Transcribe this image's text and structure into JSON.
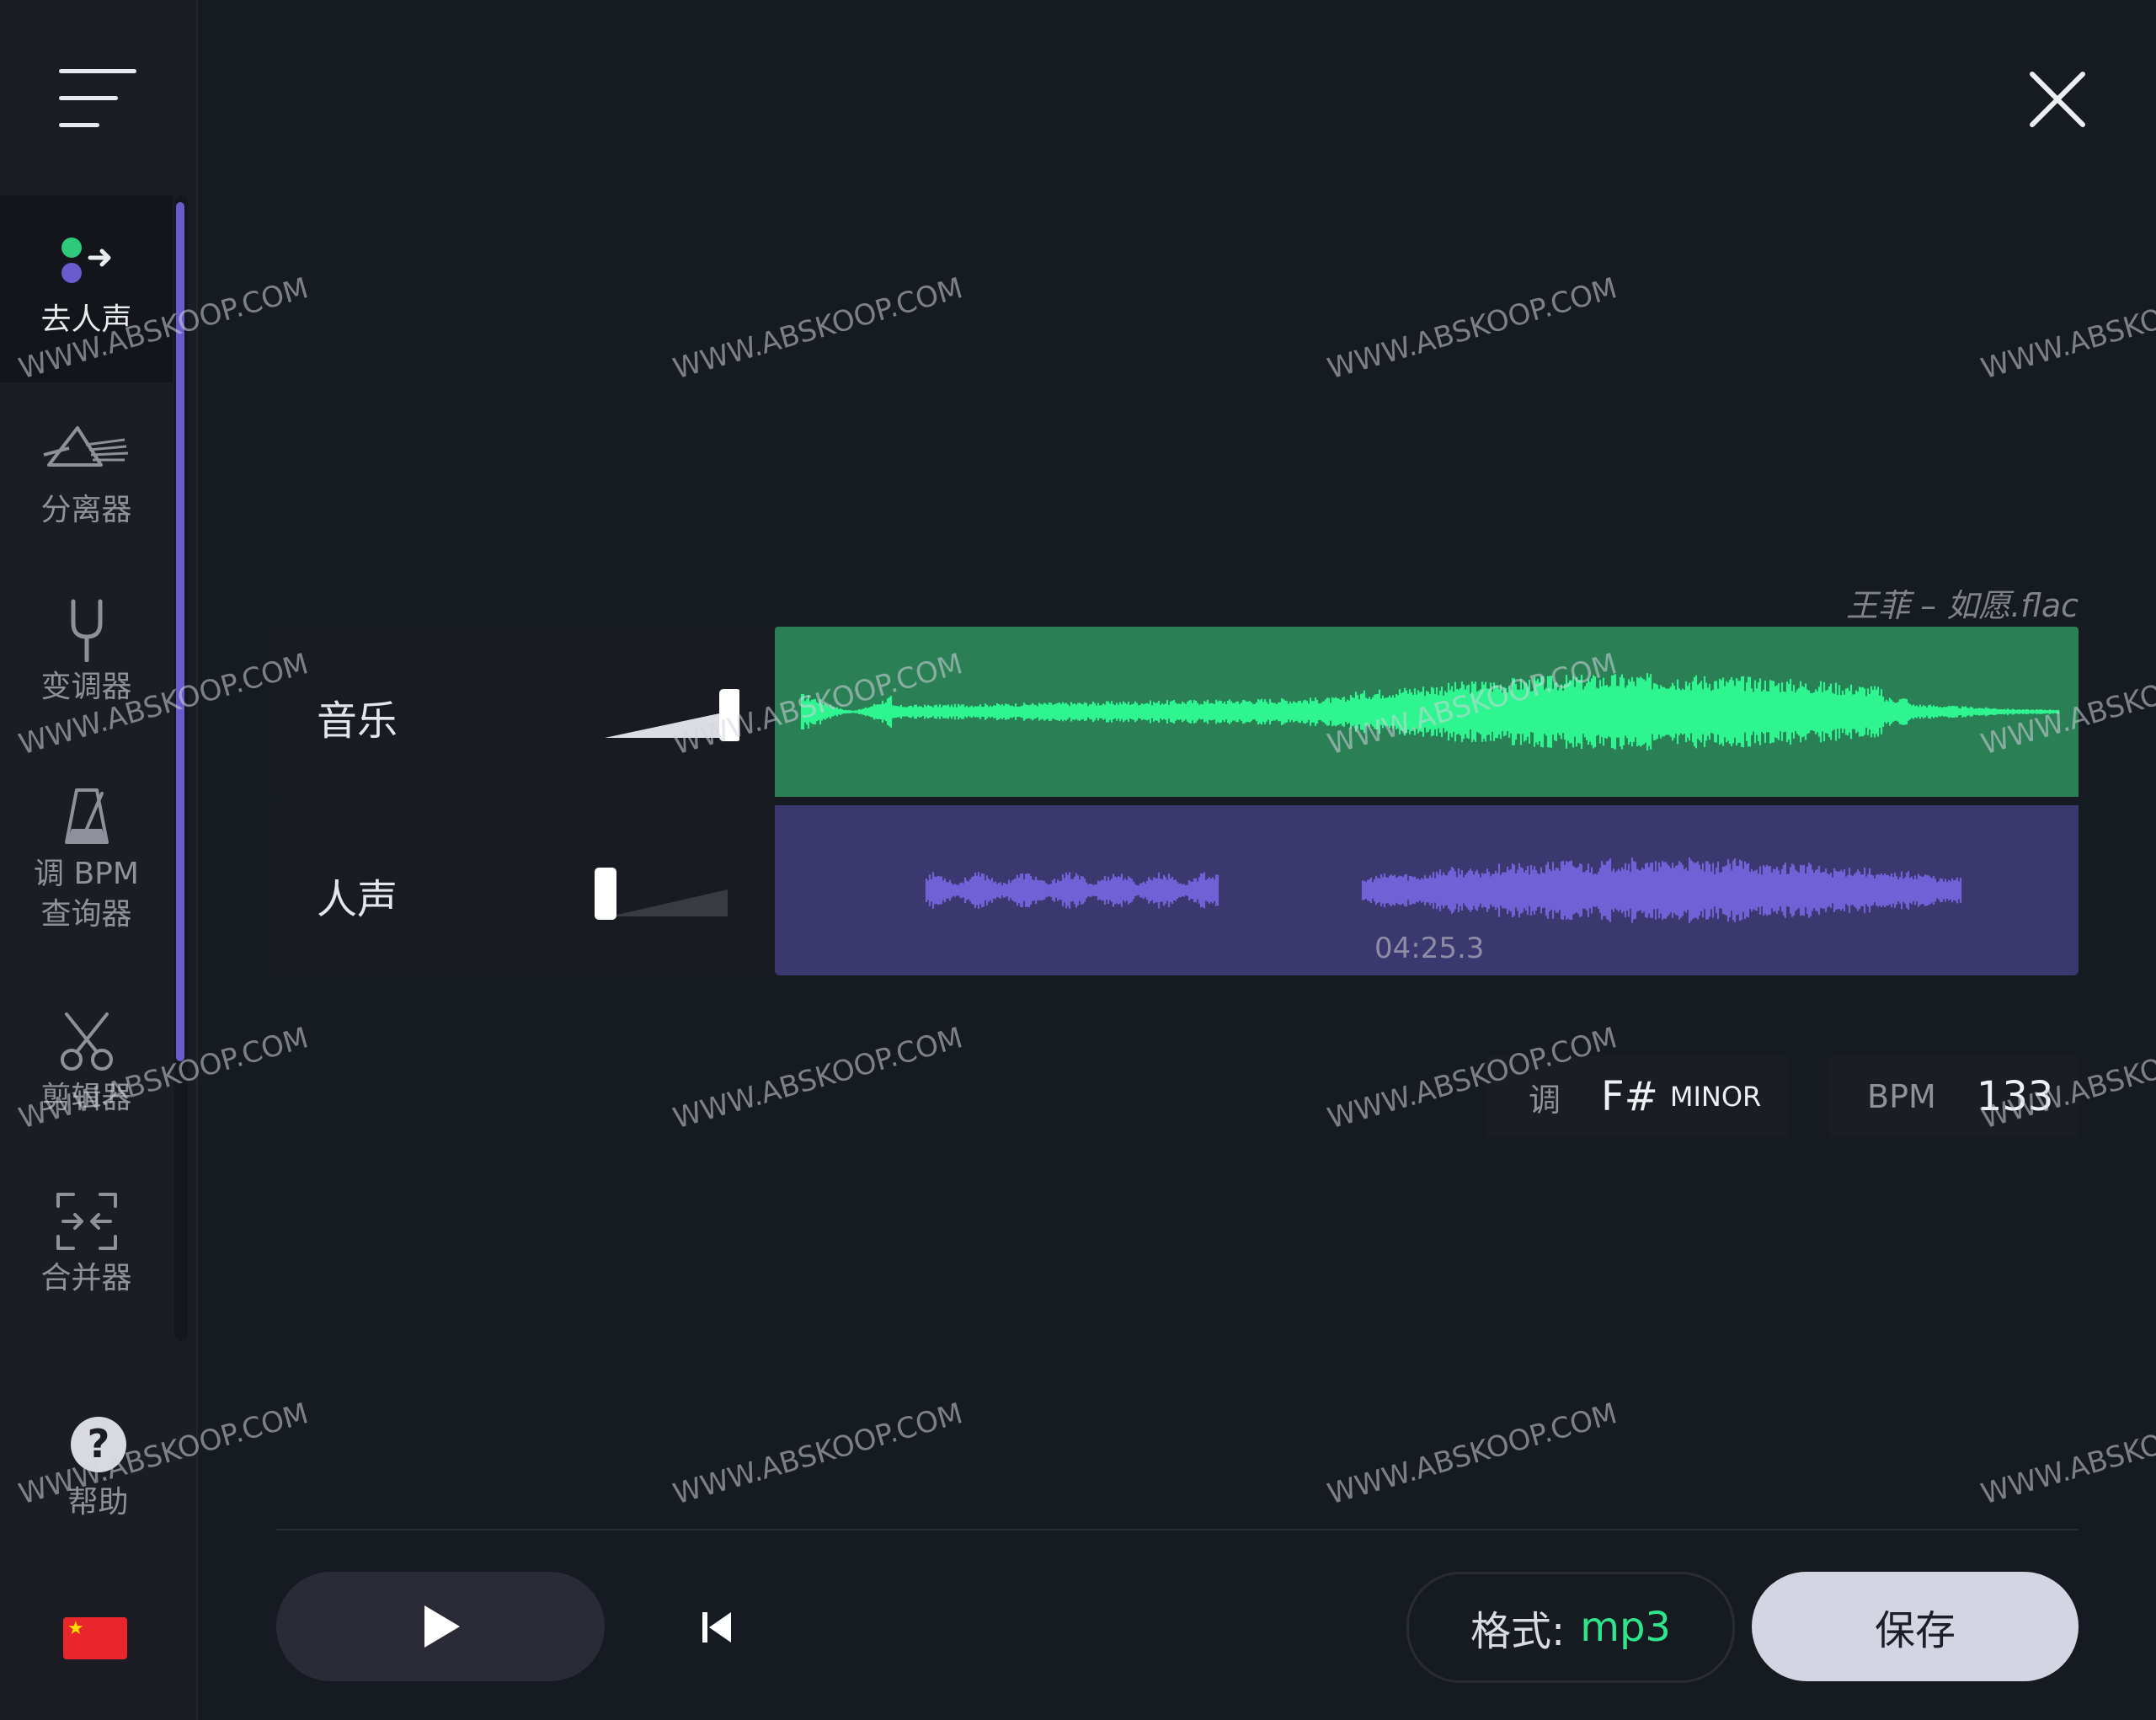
{
  "sidebar": {
    "items": [
      {
        "label": "去人声",
        "icon": "vocal-remover-icon",
        "active": true
      },
      {
        "label": "分离器",
        "icon": "prism-splitter-icon",
        "active": false
      },
      {
        "label": "变调器",
        "icon": "tuning-fork-icon",
        "active": false
      },
      {
        "label": "调 BPM\n查询器",
        "icon": "metronome-icon",
        "active": false
      },
      {
        "label": "剪辑器",
        "icon": "scissors-icon",
        "active": false
      },
      {
        "label": "合并器",
        "icon": "merge-icon",
        "active": false
      }
    ],
    "help_label": "帮助",
    "language_flag": "china-flag-icon"
  },
  "file": {
    "name": "王菲 – 如愿.flac"
  },
  "tracks": [
    {
      "label": "音乐",
      "volume": 1.0,
      "color": "#2a7f55",
      "wave_color": "#2ef58f"
    },
    {
      "label": "人声",
      "volume": 0.0,
      "color": "#3b3870",
      "wave_color": "#7261d6"
    }
  ],
  "playback": {
    "time": "04:25.3"
  },
  "key": {
    "label": "调",
    "note": "F#",
    "mode": "MINOR"
  },
  "bpm": {
    "label": "BPM",
    "value": "133"
  },
  "format": {
    "label": "格式:",
    "value": "mp3"
  },
  "save_label": "保存",
  "watermark": "WWW.ABSKOOP.COM",
  "colors": {
    "accent": "#6a5ccf",
    "green": "#2ee58c",
    "background": "#161a21"
  }
}
